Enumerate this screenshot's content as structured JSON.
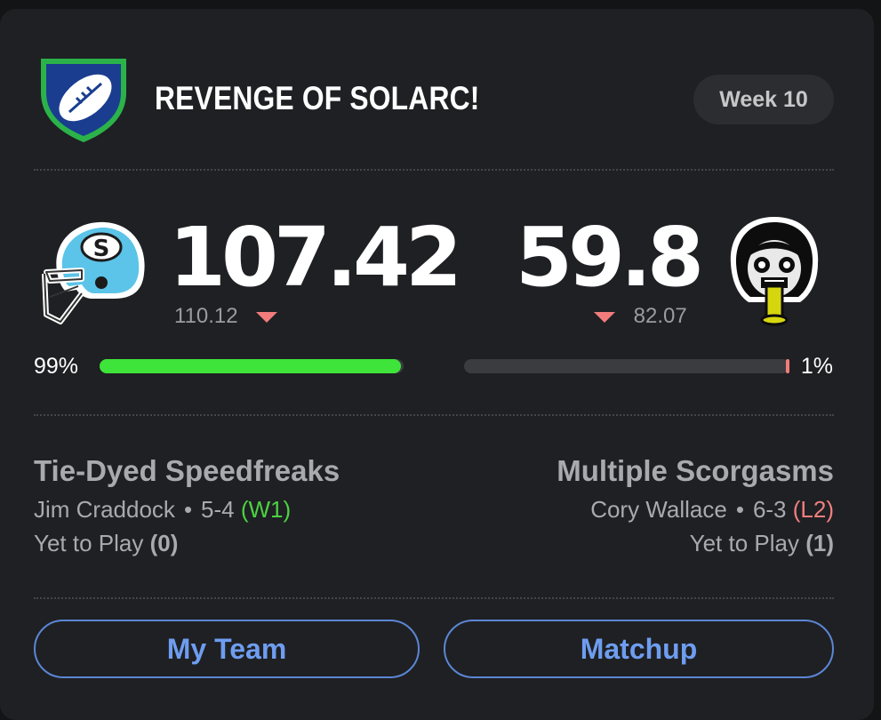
{
  "league": {
    "name": "REVENGE OF SOLARC!",
    "week": "Week 10",
    "colors": {
      "shield_border": "#2bb34a",
      "shield_fill": "#1a3d8f"
    }
  },
  "home": {
    "score": "107.42",
    "projected": "110.12",
    "win_probability": "99%",
    "win_fraction": 0.99,
    "bar_color": "#3ee43a",
    "team_name": "Tie-Dyed Speedfreaks",
    "owner": "Jim Craddock",
    "record": "5-4",
    "streak": "(W1)",
    "yet_to_play_label": "Yet to Play",
    "yet_to_play_count": "(0)",
    "avatar": "football-helmet-icon"
  },
  "away": {
    "score": "59.8",
    "projected": "82.07",
    "win_probability": "1%",
    "win_fraction": 0.01,
    "bar_color": "#f27c7c",
    "team_name": "Multiple Scorgasms",
    "owner": "Cory Wallace",
    "record": "6-3",
    "streak": "(L2)",
    "yet_to_play_label": "Yet to Play",
    "yet_to_play_count": "(1)",
    "avatar": "cartoon-face-avatar"
  },
  "separator": "•",
  "buttons": {
    "my_team": "My Team",
    "matchup": "Matchup"
  }
}
